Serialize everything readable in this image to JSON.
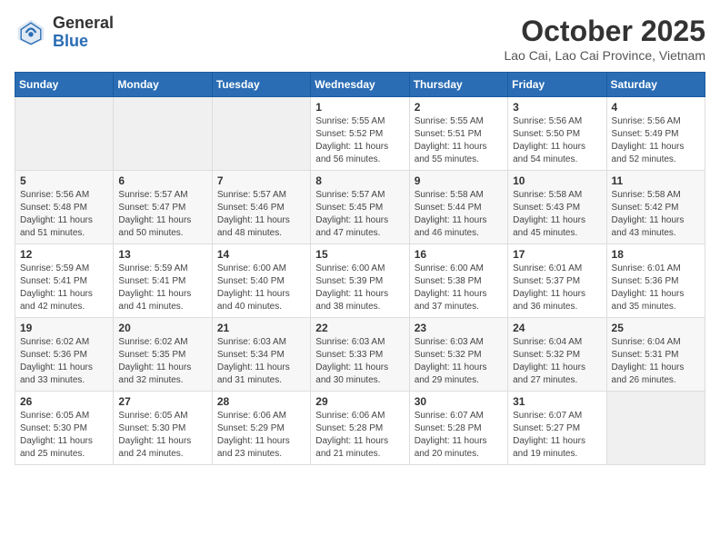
{
  "header": {
    "logo_general": "General",
    "logo_blue": "Blue",
    "month_title": "October 2025",
    "location": "Lao Cai, Lao Cai Province, Vietnam"
  },
  "weekdays": [
    "Sunday",
    "Monday",
    "Tuesday",
    "Wednesday",
    "Thursday",
    "Friday",
    "Saturday"
  ],
  "weeks": [
    [
      {
        "day": "",
        "info": ""
      },
      {
        "day": "",
        "info": ""
      },
      {
        "day": "",
        "info": ""
      },
      {
        "day": "1",
        "info": "Sunrise: 5:55 AM\nSunset: 5:52 PM\nDaylight: 11 hours and 56 minutes."
      },
      {
        "day": "2",
        "info": "Sunrise: 5:55 AM\nSunset: 5:51 PM\nDaylight: 11 hours and 55 minutes."
      },
      {
        "day": "3",
        "info": "Sunrise: 5:56 AM\nSunset: 5:50 PM\nDaylight: 11 hours and 54 minutes."
      },
      {
        "day": "4",
        "info": "Sunrise: 5:56 AM\nSunset: 5:49 PM\nDaylight: 11 hours and 52 minutes."
      }
    ],
    [
      {
        "day": "5",
        "info": "Sunrise: 5:56 AM\nSunset: 5:48 PM\nDaylight: 11 hours and 51 minutes."
      },
      {
        "day": "6",
        "info": "Sunrise: 5:57 AM\nSunset: 5:47 PM\nDaylight: 11 hours and 50 minutes."
      },
      {
        "day": "7",
        "info": "Sunrise: 5:57 AM\nSunset: 5:46 PM\nDaylight: 11 hours and 48 minutes."
      },
      {
        "day": "8",
        "info": "Sunrise: 5:57 AM\nSunset: 5:45 PM\nDaylight: 11 hours and 47 minutes."
      },
      {
        "day": "9",
        "info": "Sunrise: 5:58 AM\nSunset: 5:44 PM\nDaylight: 11 hours and 46 minutes."
      },
      {
        "day": "10",
        "info": "Sunrise: 5:58 AM\nSunset: 5:43 PM\nDaylight: 11 hours and 45 minutes."
      },
      {
        "day": "11",
        "info": "Sunrise: 5:58 AM\nSunset: 5:42 PM\nDaylight: 11 hours and 43 minutes."
      }
    ],
    [
      {
        "day": "12",
        "info": "Sunrise: 5:59 AM\nSunset: 5:41 PM\nDaylight: 11 hours and 42 minutes."
      },
      {
        "day": "13",
        "info": "Sunrise: 5:59 AM\nSunset: 5:41 PM\nDaylight: 11 hours and 41 minutes."
      },
      {
        "day": "14",
        "info": "Sunrise: 6:00 AM\nSunset: 5:40 PM\nDaylight: 11 hours and 40 minutes."
      },
      {
        "day": "15",
        "info": "Sunrise: 6:00 AM\nSunset: 5:39 PM\nDaylight: 11 hours and 38 minutes."
      },
      {
        "day": "16",
        "info": "Sunrise: 6:00 AM\nSunset: 5:38 PM\nDaylight: 11 hours and 37 minutes."
      },
      {
        "day": "17",
        "info": "Sunrise: 6:01 AM\nSunset: 5:37 PM\nDaylight: 11 hours and 36 minutes."
      },
      {
        "day": "18",
        "info": "Sunrise: 6:01 AM\nSunset: 5:36 PM\nDaylight: 11 hours and 35 minutes."
      }
    ],
    [
      {
        "day": "19",
        "info": "Sunrise: 6:02 AM\nSunset: 5:36 PM\nDaylight: 11 hours and 33 minutes."
      },
      {
        "day": "20",
        "info": "Sunrise: 6:02 AM\nSunset: 5:35 PM\nDaylight: 11 hours and 32 minutes."
      },
      {
        "day": "21",
        "info": "Sunrise: 6:03 AM\nSunset: 5:34 PM\nDaylight: 11 hours and 31 minutes."
      },
      {
        "day": "22",
        "info": "Sunrise: 6:03 AM\nSunset: 5:33 PM\nDaylight: 11 hours and 30 minutes."
      },
      {
        "day": "23",
        "info": "Sunrise: 6:03 AM\nSunset: 5:32 PM\nDaylight: 11 hours and 29 minutes."
      },
      {
        "day": "24",
        "info": "Sunrise: 6:04 AM\nSunset: 5:32 PM\nDaylight: 11 hours and 27 minutes."
      },
      {
        "day": "25",
        "info": "Sunrise: 6:04 AM\nSunset: 5:31 PM\nDaylight: 11 hours and 26 minutes."
      }
    ],
    [
      {
        "day": "26",
        "info": "Sunrise: 6:05 AM\nSunset: 5:30 PM\nDaylight: 11 hours and 25 minutes."
      },
      {
        "day": "27",
        "info": "Sunrise: 6:05 AM\nSunset: 5:30 PM\nDaylight: 11 hours and 24 minutes."
      },
      {
        "day": "28",
        "info": "Sunrise: 6:06 AM\nSunset: 5:29 PM\nDaylight: 11 hours and 23 minutes."
      },
      {
        "day": "29",
        "info": "Sunrise: 6:06 AM\nSunset: 5:28 PM\nDaylight: 11 hours and 21 minutes."
      },
      {
        "day": "30",
        "info": "Sunrise: 6:07 AM\nSunset: 5:28 PM\nDaylight: 11 hours and 20 minutes."
      },
      {
        "day": "31",
        "info": "Sunrise: 6:07 AM\nSunset: 5:27 PM\nDaylight: 11 hours and 19 minutes."
      },
      {
        "day": "",
        "info": ""
      }
    ]
  ],
  "colors": {
    "header_bg": "#2a6db5",
    "logo_blue": "#2a6db5"
  }
}
